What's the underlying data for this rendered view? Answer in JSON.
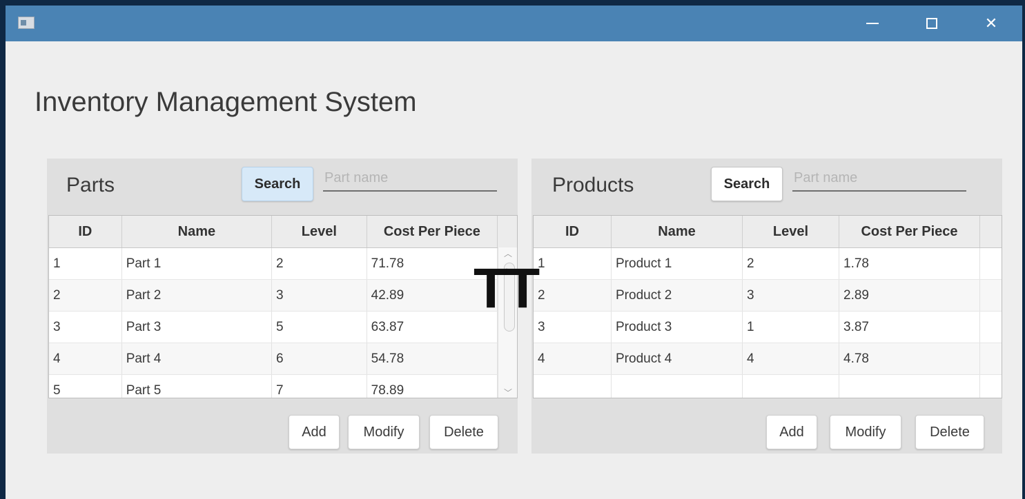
{
  "window": {
    "title_icon": "app-icon",
    "controls": {
      "minimize": "minimize",
      "maximize": "maximize",
      "close": "✕"
    }
  },
  "app": {
    "title": "Inventory Management System",
    "overlay_text": "TT"
  },
  "parts": {
    "title": "Parts",
    "search_label": "Search",
    "search_placeholder": "Part name",
    "columns": [
      "ID",
      "Name",
      "Level",
      "Cost Per Piece"
    ],
    "rows": [
      [
        "1",
        "Part 1",
        "2",
        "71.78"
      ],
      [
        "2",
        "Part 2",
        "3",
        "42.89"
      ],
      [
        "3",
        "Part 3",
        "5",
        "63.87"
      ],
      [
        "4",
        "Part 4",
        "6",
        "54.78"
      ],
      [
        "5",
        "Part 5",
        "7",
        "78.89"
      ]
    ],
    "buttons": {
      "add": "Add",
      "modify": "Modify",
      "delete": "Delete"
    }
  },
  "products": {
    "title": "Products",
    "search_label": "Search",
    "search_placeholder": "Part name",
    "columns": [
      "ID",
      "Name",
      "Level",
      "Cost Per Piece"
    ],
    "rows": [
      [
        "1",
        "Product 1",
        "2",
        "1.78"
      ],
      [
        "2",
        "Product 2",
        "3",
        "2.89"
      ],
      [
        "3",
        "Product 3",
        "1",
        "3.87"
      ],
      [
        "4",
        "Product 4",
        "4",
        "4.78"
      ]
    ],
    "buttons": {
      "add": "Add",
      "modify": "Modify",
      "delete": "Delete"
    }
  },
  "colors": {
    "titlebar": "#4a83b4",
    "search_active": "#d7e9f8",
    "background": "#eeeeee"
  }
}
